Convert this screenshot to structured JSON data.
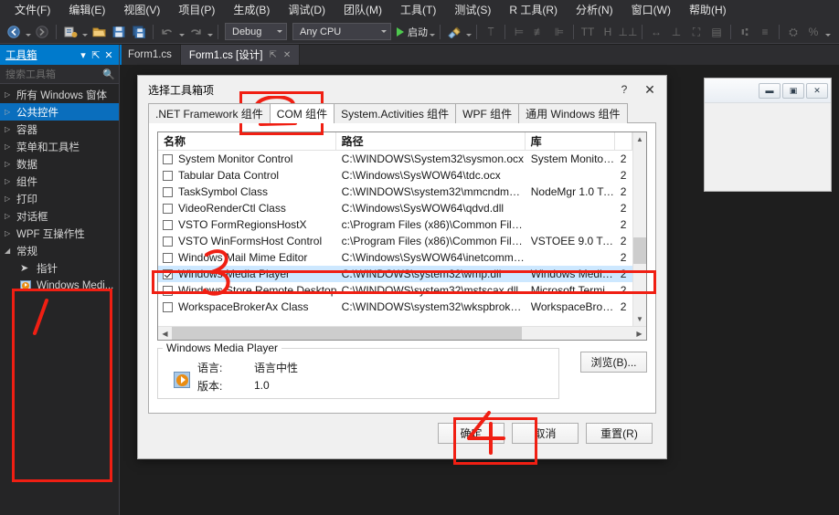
{
  "app": {
    "menus": [
      {
        "label": "文件(F)"
      },
      {
        "label": "编辑(E)"
      },
      {
        "label": "视图(V)"
      },
      {
        "label": "项目(P)"
      },
      {
        "label": "生成(B)"
      },
      {
        "label": "调试(D)"
      },
      {
        "label": "团队(M)"
      },
      {
        "label": "工具(T)"
      },
      {
        "label": "测试(S)"
      },
      {
        "label": "R 工具(R)"
      },
      {
        "label": "分析(N)"
      },
      {
        "label": "窗口(W)"
      },
      {
        "label": "帮助(H)"
      }
    ],
    "toolbar": {
      "nav_back_icon": "arrow-left-circle-icon",
      "nav_forward_icon": "arrow-right-circle-icon",
      "new_project_icon": "new-project-icon",
      "open_file_icon": "open-folder-icon",
      "save_icon": "save-icon",
      "save_all_icon": "save-all-icon",
      "undo_icon": "undo-icon",
      "redo_icon": "redo-icon",
      "config_value": "Debug",
      "platform_value": "Any CPU",
      "start_label": "启动",
      "start_icon": "play-icon",
      "attach_icon": "attach-process-icon"
    }
  },
  "toolbox": {
    "title": "工具箱",
    "dropdown_icon": "chevron-down-icon",
    "pin_icon": "pin-icon",
    "close_icon": "close-icon",
    "search_placeholder": "搜索工具箱",
    "search_icon": "search-icon",
    "items": [
      {
        "label": "所有 Windows 窗体",
        "expander": "▷",
        "selected": false
      },
      {
        "label": "公共控件",
        "expander": "▷",
        "selected": true
      },
      {
        "label": "容器",
        "expander": "▷",
        "selected": false
      },
      {
        "label": "菜单和工具栏",
        "expander": "▷",
        "selected": false
      },
      {
        "label": "数据",
        "expander": "▷",
        "selected": false
      },
      {
        "label": "组件",
        "expander": "▷",
        "selected": false
      },
      {
        "label": "打印",
        "expander": "▷",
        "selected": false
      },
      {
        "label": "对话框",
        "expander": "▷",
        "selected": false
      },
      {
        "label": "WPF 互操作性",
        "expander": "▷",
        "selected": false
      },
      {
        "label": "常规",
        "expander": "◢",
        "selected": false
      }
    ],
    "children": [
      {
        "label": "指针",
        "icon": "pointer-icon"
      },
      {
        "label": "Windows Medi...",
        "icon": "windows-media-player-icon"
      }
    ]
  },
  "editor": {
    "tabs": [
      {
        "label": "Form1.cs",
        "active": false
      },
      {
        "label": "Form1.cs [设计]",
        "active": true
      }
    ],
    "tab_pin_icon": "pin-icon",
    "tab_close_icon": "close-icon"
  },
  "background_form": {
    "minimize_icon": "minimize-icon",
    "maximize_icon": "maximize-icon",
    "close_icon": "close-icon"
  },
  "dialog": {
    "title": "选择工具箱项",
    "help_icon": "help-icon",
    "help_label": "?",
    "close_icon": "close-icon",
    "close_label": "✕",
    "tabs": [
      {
        "label": ".NET Framework 组件",
        "active": false
      },
      {
        "label": "COM 组件",
        "active": true
      },
      {
        "label": "System.Activities 组件",
        "active": false
      },
      {
        "label": "WPF 组件",
        "active": false
      },
      {
        "label": "通用 Windows 组件",
        "active": false
      }
    ],
    "columns": [
      "名称",
      "路径",
      "库",
      ""
    ],
    "rows": [
      {
        "checked": false,
        "name": "System Monitor Control",
        "path": "C:\\WINDOWS\\System32\\sysmon.ocx",
        "lib": "System Monitor ...",
        "ver": "2",
        "selected": false
      },
      {
        "checked": false,
        "name": "Tabular Data Control",
        "path": "C:\\Windows\\SysWOW64\\tdc.ocx",
        "lib": "",
        "ver": "2",
        "selected": false
      },
      {
        "checked": false,
        "name": "TaskSymbol Class",
        "path": "C:\\WINDOWS\\system32\\mmcndmgr....",
        "lib": "NodeMgr 1.0 Ty...",
        "ver": "2",
        "selected": false
      },
      {
        "checked": false,
        "name": "VideoRenderCtl Class",
        "path": "C:\\Windows\\SysWOW64\\qdvd.dll",
        "lib": "",
        "ver": "2",
        "selected": false
      },
      {
        "checked": false,
        "name": "VSTO FormRegionsHostX",
        "path": "c:\\Program Files (x86)\\Common Files...",
        "lib": "",
        "ver": "2",
        "selected": false
      },
      {
        "checked": false,
        "name": "VSTO WinFormsHost Control",
        "path": "c:\\Program Files (x86)\\Common Files...",
        "lib": "VSTOEE 9.0 Typ...",
        "ver": "2",
        "selected": false
      },
      {
        "checked": false,
        "name": "Windows Mail Mime Editor",
        "path": "C:\\Windows\\SysWOW64\\inetcomm.dll",
        "lib": "",
        "ver": "2",
        "selected": false
      },
      {
        "checked": true,
        "name": "Windows Media Player",
        "path": "C:\\WINDOWS\\system32\\wmp.dll",
        "lib": "Windows Media...",
        "ver": "2",
        "selected": true
      },
      {
        "checked": false,
        "name": "Windows Store Remote Desktop C...",
        "path": "C:\\WINDOWS\\system32\\mstscax.dll",
        "lib": "Microsoft Termi...",
        "ver": "2",
        "selected": false
      },
      {
        "checked": false,
        "name": "WorkspaceBrokerAx Class",
        "path": "C:\\WINDOWS\\system32\\wkspbroker...",
        "lib": "WorkspaceBrok...",
        "ver": "2",
        "selected": false
      }
    ],
    "detail": {
      "group_title": "Windows Media Player",
      "icon": "windows-media-player-icon",
      "language_label": "语言:",
      "language_value": "语言中性",
      "version_label": "版本:",
      "version_value": "1.0"
    },
    "browse_label": "浏览(B)...",
    "buttons": [
      {
        "label": "确定",
        "name": "ok-button"
      },
      {
        "label": "取消",
        "name": "cancel-button"
      },
      {
        "label": "重置(R)",
        "name": "reset-button"
      }
    ],
    "scroll": {
      "up_icon": "chevron-up-icon",
      "down_icon": "chevron-down-icon",
      "left_icon": "chevron-left-icon",
      "right_icon": "chevron-right-icon"
    }
  },
  "annotations": {
    "color": "#f01f13",
    "marks": [
      {
        "label": "1",
        "target": "toolbox-empty-area"
      },
      {
        "label": "2",
        "target": "com-components-tab"
      },
      {
        "label": "3",
        "target": "windows-media-player-row"
      },
      {
        "label": "4",
        "target": "ok-button"
      }
    ]
  }
}
